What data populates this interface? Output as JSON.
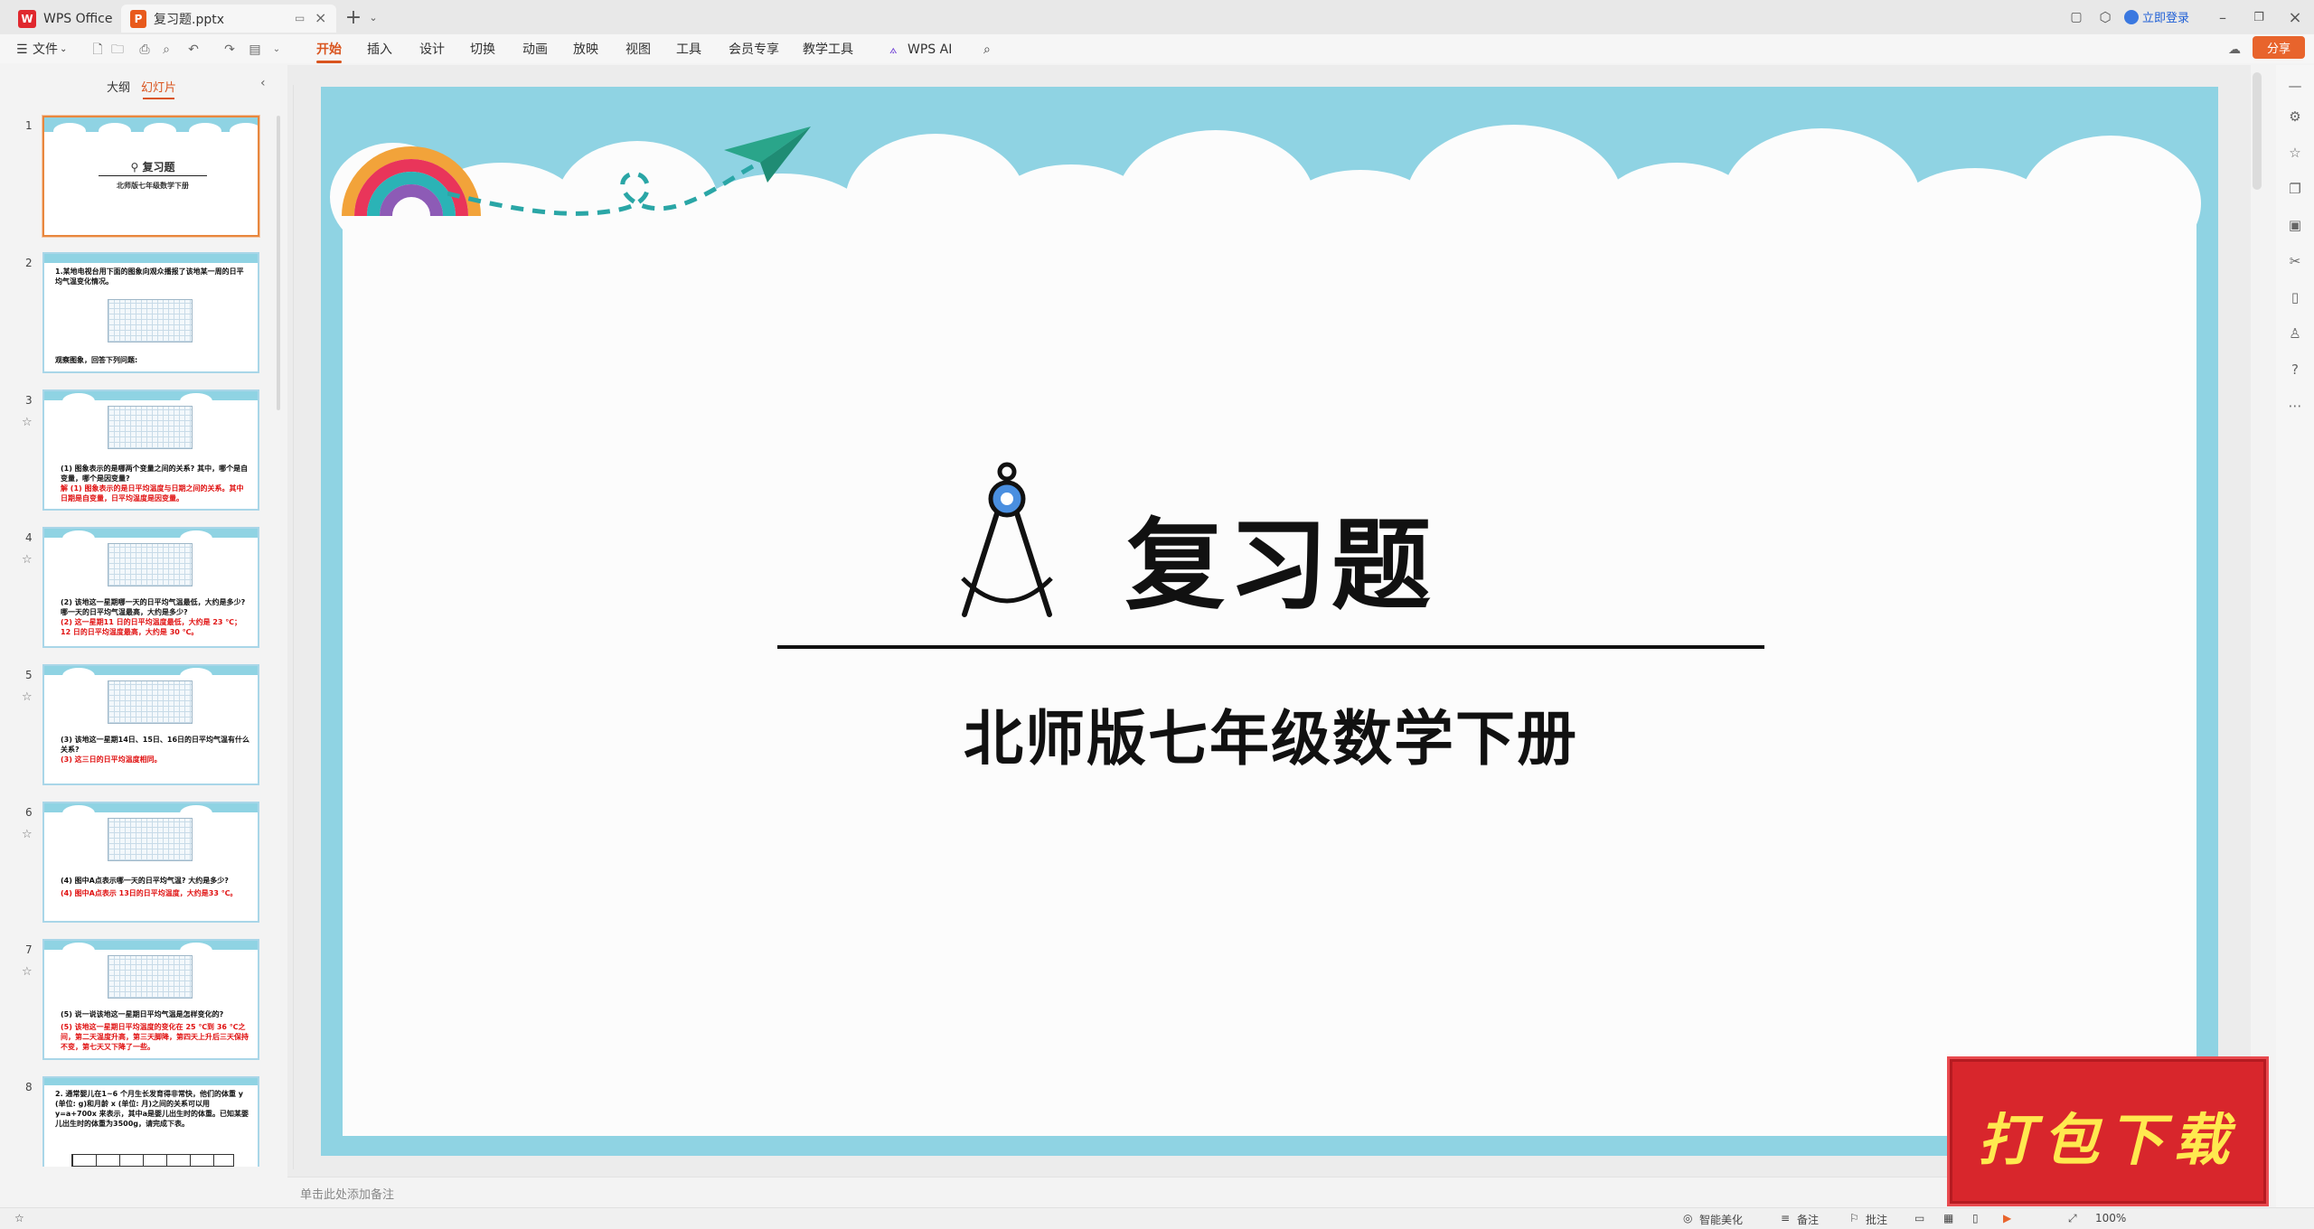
{
  "titlebar": {
    "tabs": [
      {
        "label": "WPS Office",
        "icon": "wps-logo-icon"
      },
      {
        "label": "复习题.pptx",
        "icon": "pptx-file-icon"
      }
    ],
    "login_label": "立即登录"
  },
  "menubar": {
    "file_label": "文件",
    "items": [
      "开始",
      "插入",
      "设计",
      "切换",
      "动画",
      "放映",
      "视图",
      "工具",
      "会员专享",
      "教学工具",
      "WPS AI"
    ],
    "active_item": "开始",
    "share_label": "分享"
  },
  "left_panel": {
    "tabs": [
      "大纲",
      "幻灯片"
    ],
    "active_tab": "幻灯片",
    "slides": [
      {
        "num": "1",
        "title": "复习题",
        "subtitle": "北师版七年级数学下册"
      },
      {
        "num": "2",
        "text": "1.某地电视台用下面的图象向观众播报了该地某一周的日平均气温变化情况。",
        "footer": "观察图象，回答下列问题:"
      },
      {
        "num": "3",
        "text": "(1) 图象表示的是哪两个变量之间的关系? 其中，哪个是自变量，哪个是因变量?",
        "answer": "解  (1) 图象表示的是日平均温度与日期之间的关系。其中日期是自变量，日平均温度是因变量。"
      },
      {
        "num": "4",
        "text": "(2) 该地这一星期哪一天的日平均气温最低，大约是多少? 哪一天的日平均气温最高，大约是多少?",
        "answer": "(2) 这一星期11 日的日平均温度最低，大约是 23 ℃；12 日的日平均温度最高，大约是 30 ℃。"
      },
      {
        "num": "5",
        "text": "(3) 该地这一星期14日、15日、16日的日平均气温有什么关系?",
        "answer": "(3) 这三日的日平均温度相同。"
      },
      {
        "num": "6",
        "text": "(4) 图中A点表示哪一天的日平均气温? 大约是多少?",
        "answer": "(4) 图中A点表示 13日的日平均温度，大约是33 ℃。"
      },
      {
        "num": "7",
        "text": "(5) 说一说该地这一星期日平均气温是怎样变化的?",
        "answer": "(5) 该地这一星期日平均温度的变化在 25 ℃到 36 ℃之间，第二天温度升高，第三天脚降，第四天上升后三天保持不变，第七天又下降了一些。"
      },
      {
        "num": "8",
        "text": "2. 通常婴儿在1~6 个月生长发育得非常快，他们的体重 y (单位: g)和月龄 x (单位: 月)之间的关系可以用 y=a+700x 来表示，其中a是婴儿出生时的体重。已知某婴儿出生时的体重为3500g，请完成下表。"
      }
    ]
  },
  "slide": {
    "title": "复习题",
    "subtitle": "北师版七年级数学下册"
  },
  "notes_placeholder": "单击此处添加备注",
  "statusbar": {
    "beautify_label": "智能美化",
    "notes_label": "备注",
    "comment_label": "批注",
    "zoom": "100%"
  },
  "promo_text": "打包下载",
  "colors": {
    "accent": "#d9541e",
    "sky": "#8fd3e3",
    "share": "#e8642c",
    "promo": "#d8262c"
  }
}
